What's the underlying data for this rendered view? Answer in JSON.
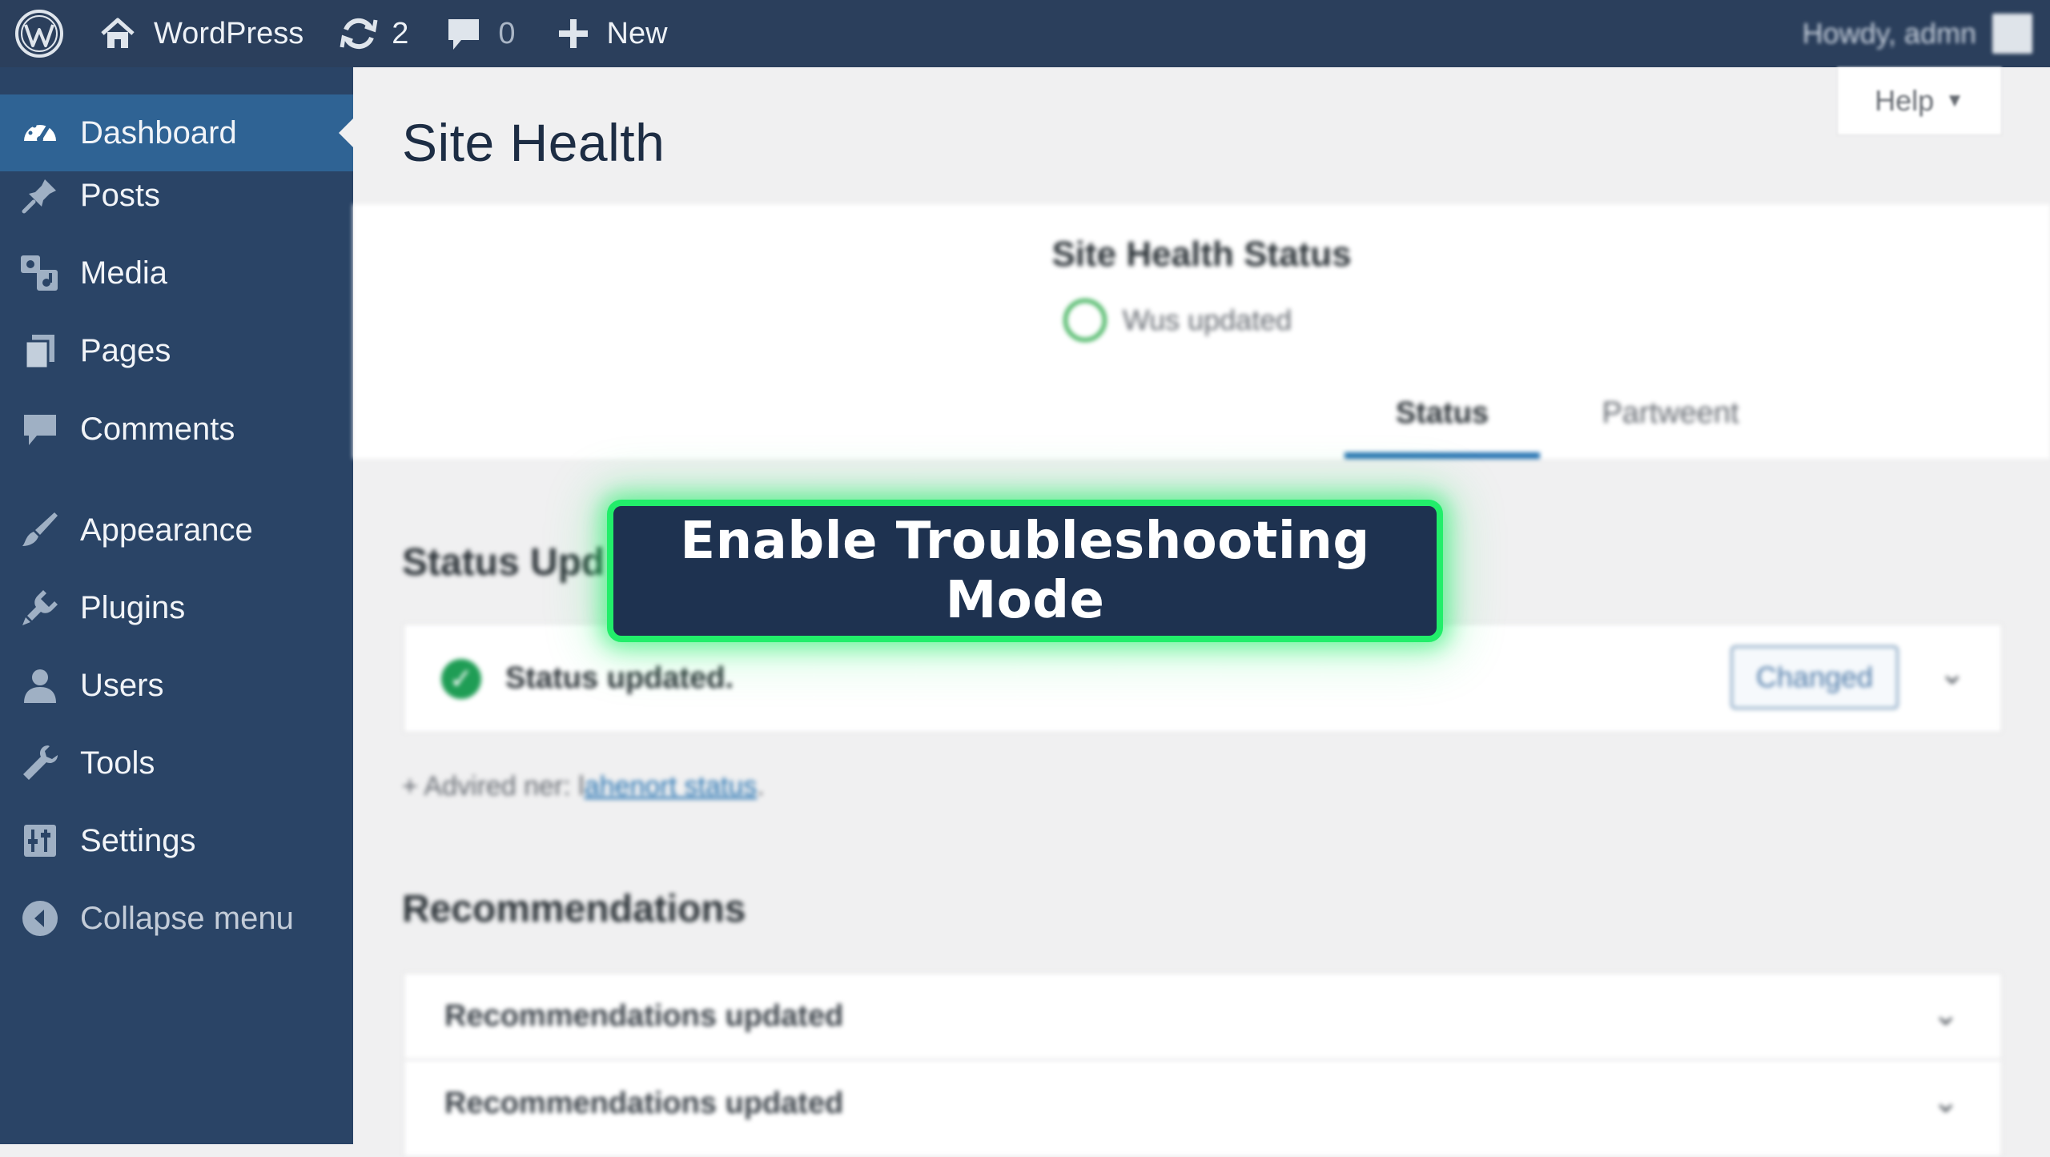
{
  "adminbar": {
    "site_name": "WordPress",
    "updates_count": "2",
    "comments_count": "0",
    "new_label": "New",
    "greeting": "Howdy, admn"
  },
  "sidebar": {
    "items": [
      {
        "label": "Dashboard",
        "icon": "dashboard-icon",
        "active": true
      },
      {
        "label": "Posts",
        "icon": "pin-icon"
      },
      {
        "label": "Media",
        "icon": "media-icon"
      },
      {
        "label": "Pages",
        "icon": "pages-icon"
      },
      {
        "label": "Comments",
        "icon": "comment-icon"
      },
      {
        "label": "Appearance",
        "icon": "brush-icon"
      },
      {
        "label": "Plugins",
        "icon": "plug-icon"
      },
      {
        "label": "Users",
        "icon": "user-icon"
      },
      {
        "label": "Tools",
        "icon": "wrench-icon"
      },
      {
        "label": "Settings",
        "icon": "settings-icon"
      },
      {
        "label": "Collapse menu",
        "icon": "collapse-icon"
      }
    ]
  },
  "main": {
    "help_label": "Help",
    "page_title": "Site Health",
    "health_status_title": "Site Health Status",
    "health_status_text": "Wus updated",
    "tabs": [
      {
        "label": "Status",
        "active": true
      },
      {
        "label": "Partweent",
        "active": false
      }
    ],
    "status_section_title": "Status Upd",
    "status_item_text": "Status updated.",
    "status_badge": "Changed",
    "advice_prefix": "+ Advired ner: l",
    "advice_link": "ahenort status",
    "advice_suffix": ".",
    "recommendations_title": "Recommendations",
    "recommendations": [
      "Recommendations updated",
      "Recommendations updated"
    ]
  },
  "overlay": {
    "button_label": "Enable Troubleshooting Mode",
    "highlight_color": "#22ee6a"
  },
  "colors": {
    "adminbar_bg": "#2b3f5c",
    "sidebar_bg": "#2a4466",
    "active_menu_bg": "#2f6394",
    "accent_blue": "#2271b1",
    "success_green": "#1f9d55"
  }
}
